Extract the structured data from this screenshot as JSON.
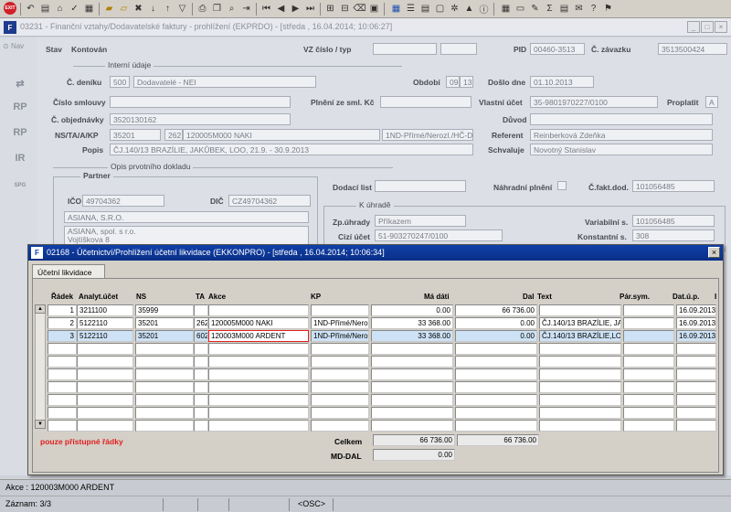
{
  "bg_window": {
    "title": "03231 - Finanční vztahy/Dodavatelské faktury - prohlížení (EKPRDO) - [středa , 16.04.2014; 10:06:27]"
  },
  "sidebar": {
    "nav_label": "Nav",
    "icons": [
      "RP",
      "RP",
      "IR",
      "SPG"
    ]
  },
  "bg_form": {
    "stav_label": "Stav",
    "stav_value": "Kontován",
    "vz_label": "VZ číslo / typ",
    "pid_label": "PID",
    "pid_value": "00460-3513",
    "zavazek_label": "Č. závazku",
    "zavazek_value": "3513500424",
    "interni_label": "Interní údaje",
    "denik_label": "Č. deníku",
    "denik_value": "500",
    "denik_name": "Dodavatelé - NEI",
    "obdobi_label": "Období",
    "obdobi_value": "09",
    "obdobi_value2": "13",
    "doslo_label": "Došlo dne",
    "doslo_value": "01.10.2013",
    "smlouvy_label": "Číslo smlouvy",
    "plneni_label": "Plnění ze sml. Kč",
    "ucet_label": "Vlastní účet",
    "ucet_value": "35-9801970227/0100",
    "proplatit_label": "Proplatit",
    "proplatit_value": "A",
    "objednavky_label": "Č. objednávky",
    "objednavky_value": "3520130162",
    "duvod_label": "Důvod",
    "ns_label": "NS/TA/A/KP",
    "ns_value": "35201",
    "ta_value": "262",
    "a_value": "120005M000 NAKI",
    "kp_value": "1ND-Přímé/Nerozl./HČ-Do",
    "referent_label": "Referent",
    "referent_value": "Reinberková Zdeňka",
    "popis_label": "Popis",
    "popis_value": "ČJ.140/13 BRAZÍLIE, JAKŮBEK, LOO, 21.9. - 30.9.2013",
    "schvaluje_label": "Schvaluje",
    "schvaluje_value": "Novotný Stanislav",
    "opis_label": "Opis prvotního dokladu",
    "partner_label": "Partner",
    "ico_label": "IČO",
    "ico_value": "49704362",
    "dic_label": "DIČ",
    "dic_value": "CZ49704362",
    "partner_name": "ASIANA, S.R.O.",
    "partner_addr1": "ASIANA, spol. s r.o.",
    "partner_addr2": "Vojtíškova 8",
    "dodaci_label": "Dodací list",
    "nahradni_label": "Náhradní plnění",
    "fakt_label": "Č.fakt.dod.",
    "fakt_value": "101056485",
    "kuhrade_label": "K úhradě",
    "zpuhrady_label": "Zp.úhrady",
    "zpuhrady_value": "Příkazem",
    "variabilni_label": "Variabilní s.",
    "variabilni_value": "101056485",
    "cizi_label": "Cizí účet",
    "cizi_value": "51-903270247/0100",
    "konstantni_label": "Konstantní s.",
    "konstantni_value": "308"
  },
  "modal": {
    "title": "02168 - Účetnictví/Prohlížení účetní likvidace (EKKONPRO) - [středa , 16.04.2014; 10:06:34]",
    "close": "×",
    "tab": "Účetní likvidace",
    "headers": {
      "radek": "Řádek",
      "analyt": "Analyt.účet",
      "ns": "NS",
      "ta": "TA",
      "akce": "Akce",
      "kp": "KP",
      "madati": "Má dáti",
      "dal": "Dal",
      "text": "Text",
      "parsym": "Pár.sym.",
      "datup": "Dat.ú.p.",
      "extra": "I"
    },
    "rows": [
      {
        "radek": "1",
        "analyt": "3211100",
        "ns": "35999",
        "ta": "",
        "akce": "",
        "kp": "",
        "madati": "0.00",
        "dal": "66 736.00",
        "text": "",
        "parsym": "",
        "datup": "16.09.2013"
      },
      {
        "radek": "2",
        "analyt": "5122110",
        "ns": "35201",
        "ta": "262",
        "akce": "120005M000 NAKI",
        "kp": "1ND-Přímé/Nero",
        "madati": "33 368.00",
        "dal": "0.00",
        "text": "ČJ.140/13 BRAZÍLIE, JA",
        "parsym": "",
        "datup": "16.09.2013"
      },
      {
        "radek": "3",
        "analyt": "5122110",
        "ns": "35201",
        "ta": "602",
        "akce": "120003M000 ARDENT",
        "kp": "1ND-Přímé/Nero",
        "madati": "33 368.00",
        "dal": "0.00",
        "text": "ČJ.140/13 BRAZÍLIE,LO",
        "parsym": "",
        "datup": "16.09.2013"
      }
    ],
    "note": "pouze přístupné řádky",
    "celkem_label": "Celkem",
    "celkem_madati": "66 736.00",
    "celkem_dal": "66 736.00",
    "mddal_label": "MD-DAL",
    "mddal_value": "0.00"
  },
  "status": {
    "line1": "Akce : 120003M000 ARDENT",
    "zaznam": "Záznam: 3/3",
    "osc": "<OSC>"
  },
  "colors": {
    "title_bar": "#0a2f86",
    "selected_row": "#cde2f5",
    "note_red": "#e02020",
    "exit_red": "#d0212b"
  }
}
